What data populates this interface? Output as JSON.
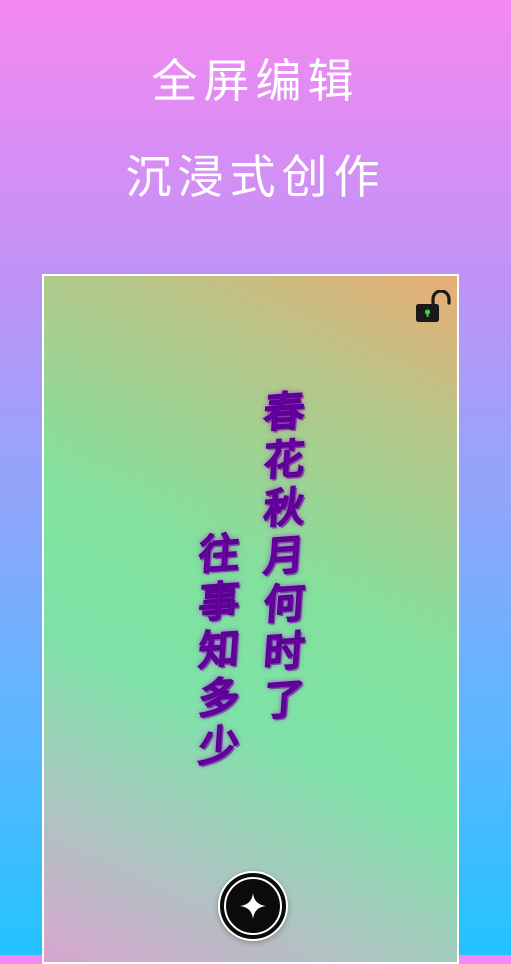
{
  "headline": {
    "line1": "全屏编辑",
    "line2": "沉浸式创作"
  },
  "canvas": {
    "lock_icon": "unlocked-padlock-icon",
    "lock_accent": "#39d353",
    "poem": {
      "column1": [
        "春",
        "花",
        "秋",
        "月",
        "何",
        "时",
        "了"
      ],
      "column2": [
        "往",
        "事",
        "知",
        "多",
        "少"
      ],
      "color": "#7a00b5"
    },
    "fab_icon": "sparkle-star-icon"
  },
  "colors": {
    "background_top": "#f489f2",
    "background_bottom": "#22c3ff",
    "headline": "#ffffff"
  }
}
